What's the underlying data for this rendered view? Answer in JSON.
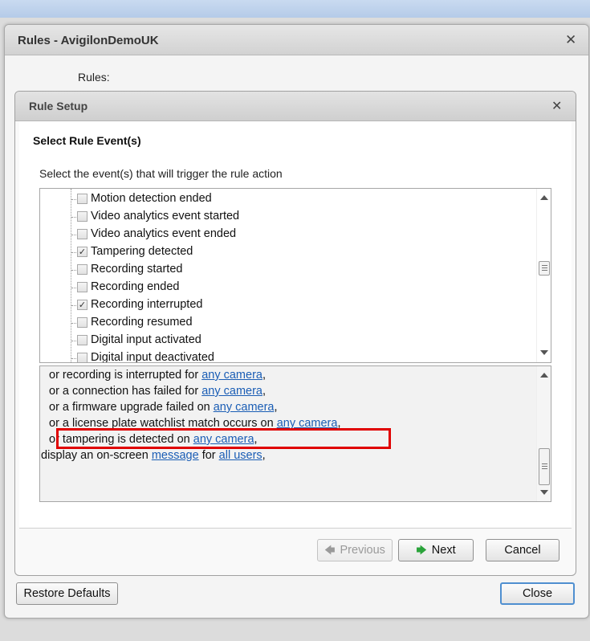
{
  "outer_window": {
    "title": "Rules - AvigilonDemoUK",
    "rules_label": "Rules:",
    "close_glyph": "✕"
  },
  "rule_setup": {
    "title": "Rule Setup",
    "close_glyph": "✕",
    "section_title": "Select Rule Event(s)",
    "instruction": "Select the event(s) that will trigger the rule action",
    "events": [
      {
        "label": "Motion detection ended",
        "checked": false
      },
      {
        "label": "Video analytics event started",
        "checked": false
      },
      {
        "label": "Video analytics event ended",
        "checked": false
      },
      {
        "label": "Tampering detected",
        "checked": true
      },
      {
        "label": "Recording started",
        "checked": false
      },
      {
        "label": "Recording ended",
        "checked": false
      },
      {
        "label": "Recording interrupted",
        "checked": true
      },
      {
        "label": "Recording resumed",
        "checked": false
      },
      {
        "label": "Digital input activated",
        "checked": false
      },
      {
        "label": "Digital input deactivated",
        "checked": false
      }
    ],
    "summary": [
      {
        "pre": "or recording is interrupted for ",
        "link": "any camera",
        "post": ","
      },
      {
        "pre": "or a connection has failed for ",
        "link": "any camera",
        "post": ","
      },
      {
        "pre": "or a firmware upgrade failed on ",
        "link": "any camera",
        "post": ","
      },
      {
        "pre": "or a license plate watchlist match occurs on ",
        "link": "any camera",
        "post": ","
      },
      {
        "pre": "or tampering is detected on ",
        "link": "any camera",
        "post": ","
      },
      {
        "pre": "display an on-screen ",
        "link": "message",
        "mid": " for ",
        "link2": "all users",
        "post": ","
      }
    ],
    "buttons": {
      "previous": "Previous",
      "next": "Next",
      "cancel": "Cancel"
    },
    "highlight_color": "#e00000"
  },
  "footer": {
    "restore_defaults": "Restore Defaults",
    "close": "Close"
  },
  "icons": {
    "previous": "arrow-left-icon",
    "next": "arrow-right-icon"
  }
}
